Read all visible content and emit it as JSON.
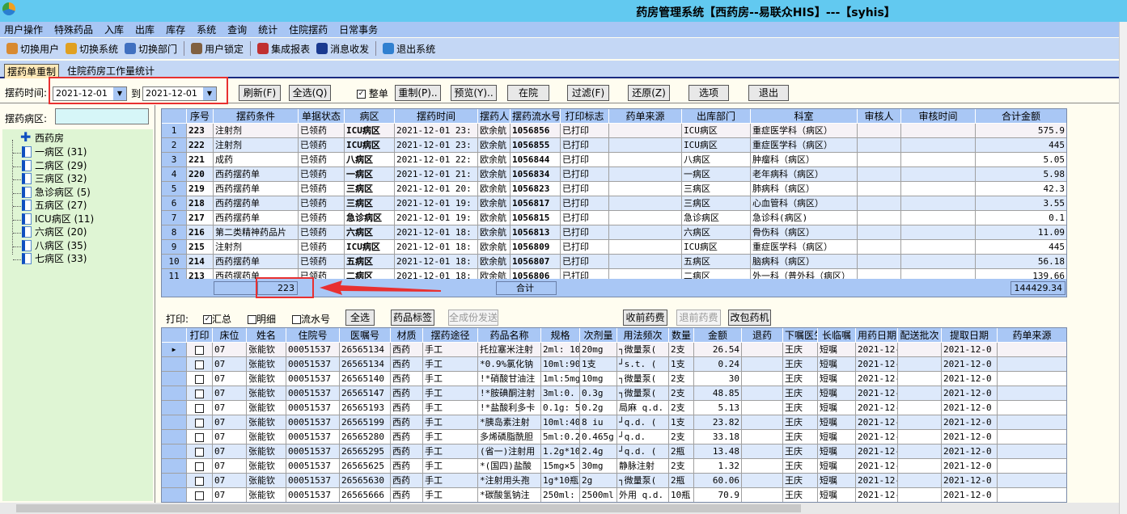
{
  "window": {
    "title": "药房管理系统【西药房--易联众HIS】---【syhis】"
  },
  "menu": [
    "用户操作",
    "特殊药品",
    "入库",
    "出库",
    "库存",
    "系统",
    "查询",
    "统计",
    "住院摆药",
    "日常事务"
  ],
  "toolbar": [
    {
      "label": "切换用户",
      "icon": "users-icon",
      "color": "#d88a30"
    },
    {
      "label": "切换系统",
      "icon": "switch-icon",
      "color": "#e0a020"
    },
    {
      "label": "切换部门",
      "icon": "calendar-icon",
      "color": "#4070c0"
    },
    {
      "label": "用户锁定",
      "icon": "lock-user-icon",
      "color": "#806040"
    },
    {
      "label": "集成报表",
      "icon": "report-icon",
      "color": "#c03030"
    },
    {
      "label": "消息收发",
      "icon": "info-icon",
      "color": "#1a3a90"
    },
    {
      "label": "退出系统",
      "icon": "exit-icon",
      "color": "#3080d0"
    }
  ],
  "tabs": [
    "摆药单重制",
    "住院药房工作量统计"
  ],
  "filter": {
    "time_label": "摆药时间:",
    "from": "2021-12-01",
    "to_label": "到",
    "to": "2021-12-01",
    "buttons": [
      "刷新(F)",
      "全选(Q)",
      "重制(P)..",
      "预览(Y)..",
      "在院",
      "过滤(F)",
      "还原(Z)",
      "选项",
      "退出"
    ],
    "whole_label": "整单",
    "whole_checked": true
  },
  "ward": {
    "label": "摆药病区:",
    "value": "",
    "root": "西药房",
    "items": [
      "一病区 (31)",
      "二病区 (29)",
      "三病区 (32)",
      "急诊病区 (5)",
      "五病区 (27)",
      "ICU病区 (11)",
      "六病区 (20)",
      "八病区 (35)",
      "七病区 (33)"
    ]
  },
  "top_table": {
    "columns": [
      "序号",
      "摆药条件",
      "单据状态",
      "病区",
      "摆药时间",
      "摆药人",
      "摆药流水号",
      "打印标志",
      "药单来源",
      "出库部门",
      "科室",
      "审核人",
      "审核时间",
      "合计金额"
    ],
    "rows": [
      [
        "223",
        "注射剂",
        "已领药",
        "ICU病区",
        "2021-12-01 23:",
        "欧余航",
        "1056856",
        "已打印",
        "",
        "ICU病区",
        "重症医学科（病区）",
        "",
        "",
        "575.9"
      ],
      [
        "222",
        "注射剂",
        "已领药",
        "ICU病区",
        "2021-12-01 23:",
        "欧余航",
        "1056855",
        "已打印",
        "",
        "ICU病区",
        "重症医学科（病区）",
        "",
        "",
        "445"
      ],
      [
        "221",
        "成药",
        "已领药",
        "八病区",
        "2021-12-01 22:",
        "欧余航",
        "1056844",
        "已打印",
        "",
        "八病区",
        "肿瘤科（病区）",
        "",
        "",
        "5.05"
      ],
      [
        "220",
        "西药摆药单",
        "已领药",
        "一病区",
        "2021-12-01 21:",
        "欧余航",
        "1056834",
        "已打印",
        "",
        "一病区",
        "老年病科（病区）",
        "",
        "",
        "5.98"
      ],
      [
        "219",
        "西药摆药单",
        "已领药",
        "三病区",
        "2021-12-01 20:",
        "欧余航",
        "1056823",
        "已打印",
        "",
        "三病区",
        "肺病科（病区）",
        "",
        "",
        "42.3"
      ],
      [
        "218",
        "西药摆药单",
        "已领药",
        "三病区",
        "2021-12-01 19:",
        "欧余航",
        "1056817",
        "已打印",
        "",
        "三病区",
        "心血管科（病区）",
        "",
        "",
        "3.55"
      ],
      [
        "217",
        "西药摆药单",
        "已领药",
        "急诊病区",
        "2021-12-01 19:",
        "欧余航",
        "1056815",
        "已打印",
        "",
        "急诊病区",
        "急诊科(病区)",
        "",
        "",
        "0.1"
      ],
      [
        "216",
        "第二类精神药品片",
        "已领药",
        "六病区",
        "2021-12-01 18:",
        "欧余航",
        "1056813",
        "已打印",
        "",
        "六病区",
        "骨伤科（病区）",
        "",
        "",
        "11.09"
      ],
      [
        "215",
        "注射剂",
        "已领药",
        "ICU病区",
        "2021-12-01 18:",
        "欧余航",
        "1056809",
        "已打印",
        "",
        "ICU病区",
        "重症医学科（病区）",
        "",
        "",
        "445"
      ],
      [
        "214",
        "西药摆药单",
        "已领药",
        "五病区",
        "2021-12-01 18:",
        "欧余航",
        "1056807",
        "已打印",
        "",
        "五病区",
        "脑病科（病区）",
        "",
        "",
        "56.18"
      ],
      [
        "213",
        "西药摆药单",
        "已领药",
        "二病区",
        "2021-12-01 18:",
        "欧余航",
        "1056806",
        "已打印",
        "",
        "二病区",
        "外一科（普外科（病区）",
        "",
        "",
        "139.66"
      ]
    ],
    "footer": {
      "count": "223",
      "total_label": "合计",
      "total": "144429.34"
    }
  },
  "print_bar": {
    "label": "打印:",
    "options": [
      {
        "label": "汇总",
        "checked": true
      },
      {
        "label": "明细",
        "checked": false
      },
      {
        "label": "流水号",
        "checked": false
      }
    ],
    "buttons": [
      "全选",
      "药品标签",
      "全成份发送",
      "收前药费",
      "退前药费",
      "改包药机"
    ]
  },
  "bottom_table": {
    "columns": [
      "打印",
      "床位",
      "姓名",
      "住院号",
      "医嘱号",
      "材质",
      "摆药途径",
      "药品名称",
      "规格",
      "次剂量",
      "用法频次",
      "数量",
      "金额",
      "退药",
      "下嘱医生",
      "长临嘱",
      "用药日期",
      "配送批次",
      "提取日期",
      "药单来源"
    ],
    "rows": [
      [
        "",
        "07",
        "张能钦",
        "00051537",
        "26565134",
        "西药",
        "手工",
        "托拉塞米注射",
        "2ml: 10",
        "20mg",
        "┐微量泵(",
        "2支",
        "26.54",
        "",
        "王庆",
        "短嘱",
        "2021-12-",
        "",
        "2021-12-0",
        ""
      ],
      [
        "",
        "07",
        "张能钦",
        "00051537",
        "26565134",
        "西药",
        "手工",
        "*0.9%氯化钠",
        "10ml:90",
        "1支",
        "┘s.t. (",
        "1支",
        "0.24",
        "",
        "王庆",
        "短嘱",
        "2021-12-",
        "",
        "2021-12-0",
        ""
      ],
      [
        "",
        "07",
        "张能钦",
        "00051537",
        "26565140",
        "西药",
        "手工",
        "!*硝酸甘油注",
        "1ml:5mg",
        "10mg",
        "┐微量泵(",
        "2支",
        "30",
        "",
        "王庆",
        "短嘱",
        "2021-12-",
        "",
        "2021-12-0",
        ""
      ],
      [
        "",
        "07",
        "张能钦",
        "00051537",
        "26565147",
        "西药",
        "手工",
        "!*胺碘酮注射",
        "3ml:0.",
        "0.3g",
        "┐微量泵(",
        "2支",
        "48.85",
        "",
        "王庆",
        "短嘱",
        "2021-12-",
        "",
        "2021-12-0",
        ""
      ],
      [
        "",
        "07",
        "张能钦",
        "00051537",
        "26565193",
        "西药",
        "手工",
        "!*盐酸利多卡",
        "0.1g: 5",
        "0.2g",
        "局麻 q.d.",
        "2支",
        "5.13",
        "",
        "王庆",
        "短嘱",
        "2021-12-",
        "",
        "2021-12-0",
        ""
      ],
      [
        "",
        "07",
        "张能钦",
        "00051537",
        "26565199",
        "西药",
        "手工",
        "*胰岛素注射",
        "10ml:40",
        "8 iu",
        "┘q.d. (",
        "1支",
        "23.82",
        "",
        "王庆",
        "短嘱",
        "2021-12-",
        "",
        "2021-12-0",
        ""
      ],
      [
        "",
        "07",
        "张能钦",
        "00051537",
        "26565280",
        "西药",
        "手工",
        "多烯磷脂酰胆",
        "5ml:0.2",
        "0.465g",
        "┘q.d.",
        "2支",
        "33.18",
        "",
        "王庆",
        "短嘱",
        "2021-12-",
        "",
        "2021-12-0",
        ""
      ],
      [
        "",
        "07",
        "张能钦",
        "00051537",
        "26565295",
        "西药",
        "手工",
        "(省一)注射用",
        "1.2g*10",
        "2.4g",
        "┘q.d. (",
        "2瓶",
        "13.48",
        "",
        "王庆",
        "短嘱",
        "2021-12-",
        "",
        "2021-12-0",
        ""
      ],
      [
        "",
        "07",
        "张能钦",
        "00051537",
        "26565625",
        "西药",
        "手工",
        "*(国四)盐酸",
        "15mg×5",
        "30mg",
        "静脉注射",
        "2支",
        "1.32",
        "",
        "王庆",
        "短嘱",
        "2021-12-",
        "",
        "2021-12-0",
        ""
      ],
      [
        "",
        "07",
        "张能钦",
        "00051537",
        "26565630",
        "西药",
        "手工",
        "*注射用头孢",
        "1g*10瓶",
        "2g",
        "┐微量泵(",
        "2瓶",
        "60.06",
        "",
        "王庆",
        "短嘱",
        "2021-12-",
        "",
        "2021-12-0",
        ""
      ],
      [
        "",
        "07",
        "张能钦",
        "00051537",
        "26565666",
        "西药",
        "手工",
        "*碳酸氢钠注",
        "250ml:",
        "2500ml",
        "外用 q.d.",
        "10瓶",
        "70.9",
        "",
        "王庆",
        "短嘱",
        "2021-12-",
        "",
        "2021-12-0",
        ""
      ]
    ]
  }
}
